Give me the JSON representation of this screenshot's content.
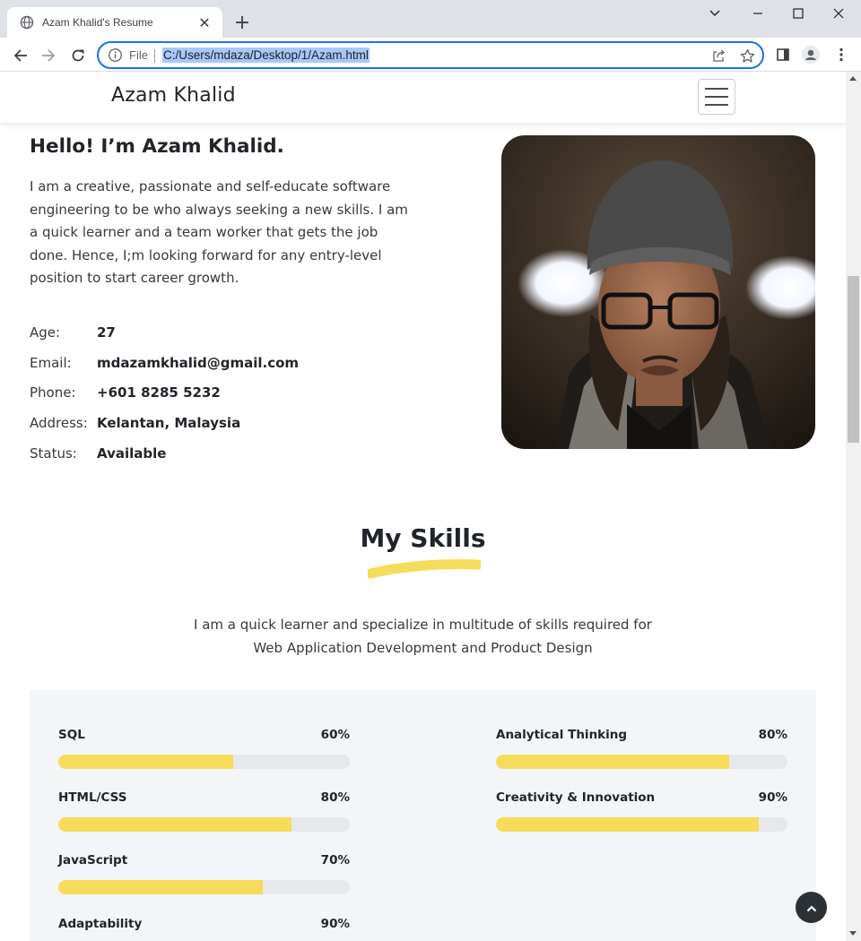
{
  "browser": {
    "tab_title": "Azam Khalid's Resume",
    "tab_close": "✕",
    "new_tab": "+",
    "address_prefix": "File",
    "address_url": "C:/Users/mdaza/Desktop/1/Azam.html"
  },
  "site": {
    "brand": "Azam Khalid"
  },
  "hero": {
    "greeting": "Hello! I’m Azam Khalid.",
    "about": "I am a creative, passionate and self-educate software engineering to be who always seeking a new skills. I am a quick learner and a team worker that gets the job done. Hence, I;m looking forward for any entry-level position to start career growth.",
    "info": [
      {
        "label": "Age:",
        "value": "27"
      },
      {
        "label": "Email:",
        "value": "mdazamkhalid@gmail.com"
      },
      {
        "label": "Phone:",
        "value": "+601 8285 5232"
      },
      {
        "label": "Address:",
        "value": "Kelantan, Malaysia"
      },
      {
        "label": "Status:",
        "value": "Available"
      }
    ]
  },
  "skills": {
    "title": "My Skills",
    "description": "I am a quick learner and specialize in multitude of skills required for Web Application Development and Product Design",
    "items": [
      {
        "name": "SQL",
        "percent_label": "60%",
        "level": 0.6
      },
      {
        "name": "HTML/CSS",
        "percent_label": "80%",
        "level": 0.8
      },
      {
        "name": "JavaScript",
        "percent_label": "70%",
        "level": 0.7
      },
      {
        "name": "Adaptability",
        "percent_label": "90%",
        "level": 0.9
      },
      {
        "name": "Analytical Thinking",
        "percent_label": "80%",
        "level": 0.8
      },
      {
        "name": "Creativity & Innovation",
        "percent_label": "90%",
        "level": 0.9
      }
    ]
  },
  "colors": {
    "accent_yellow": "#f5dc5a",
    "panel_bg": "#f4f5f7",
    "text_dark": "#212529",
    "omnibox_focus": "#1a73e8"
  },
  "icons": {
    "tab_favicon": "globe-icon",
    "scroll_to_top": "chevron-up-icon",
    "menu": "hamburger-icon"
  }
}
